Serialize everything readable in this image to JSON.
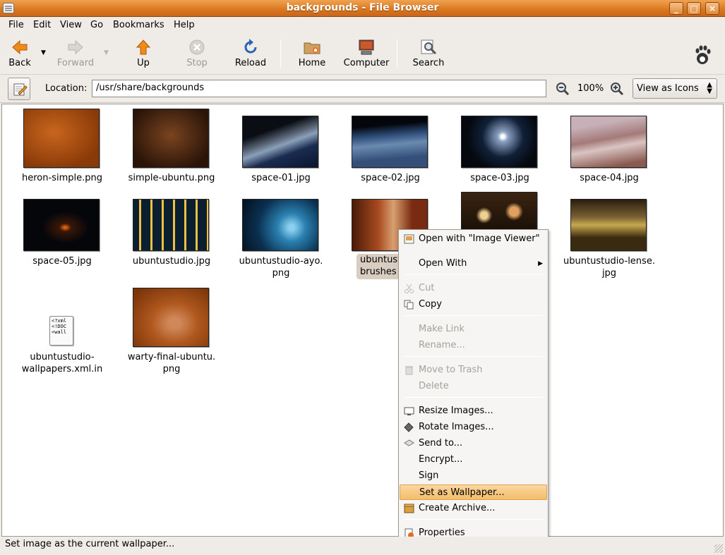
{
  "window": {
    "title": "backgrounds - File Browser",
    "buttons": [
      "_",
      "□",
      "×"
    ]
  },
  "menubar": [
    "File",
    "Edit",
    "View",
    "Go",
    "Bookmarks",
    "Help"
  ],
  "toolbar": {
    "back": "Back",
    "forward": "Forward",
    "up": "Up",
    "stop": "Stop",
    "reload": "Reload",
    "home": "Home",
    "computer": "Computer",
    "search": "Search"
  },
  "location": {
    "label": "Location:",
    "path": "/usr/share/backgrounds",
    "zoom": "100%",
    "view_mode": "View as Icons"
  },
  "files": [
    {
      "name": "heron-simple.png",
      "icon": "orange-texture"
    },
    {
      "name": "simple-ubuntu.png",
      "icon": "brown-texture"
    },
    {
      "name": "space-01.jpg",
      "icon": "space-station"
    },
    {
      "name": "space-02.jpg",
      "icon": "earth-from-orbit"
    },
    {
      "name": "space-03.jpg",
      "icon": "sunrise-orbit"
    },
    {
      "name": "space-04.jpg",
      "icon": "spacecraft-clouds"
    },
    {
      "name": "space-05.jpg",
      "icon": "dark-horizon"
    },
    {
      "name": "ubuntustudio.jpg",
      "icon": "mixer-console"
    },
    {
      "name": "ubuntustudio-ayo.\npng",
      "icon": "blue-abstract"
    },
    {
      "name": "ubuntust\nbrushes",
      "icon": "brushes"
    },
    {
      "name": "",
      "icon": "bokeh"
    },
    {
      "name": "ubuntustudio-lense.\njpg",
      "icon": "macro-lens"
    },
    {
      "name": "ubuntustudio-\nwallpapers.xml.in",
      "icon": "xml-file"
    },
    {
      "name": "warty-final-ubuntu.\npng",
      "icon": "heron-orange"
    }
  ],
  "xml_icon_text": "<?xml\n<!DOC\n<wall",
  "context_menu": {
    "open_viewer": "Open with \"Image Viewer\"",
    "open_with": "Open With",
    "cut": "Cut",
    "copy": "Copy",
    "make_link": "Make Link",
    "rename": "Rename...",
    "move_trash": "Move to Trash",
    "delete": "Delete",
    "resize": "Resize Images...",
    "rotate": "Rotate Images...",
    "send_to": "Send to...",
    "encrypt": "Encrypt...",
    "sign": "Sign",
    "set_wallpaper": "Set as Wallpaper...",
    "create_archive": "Create Archive...",
    "properties": "Properties"
  },
  "status": "Set image as the current wallpaper..."
}
